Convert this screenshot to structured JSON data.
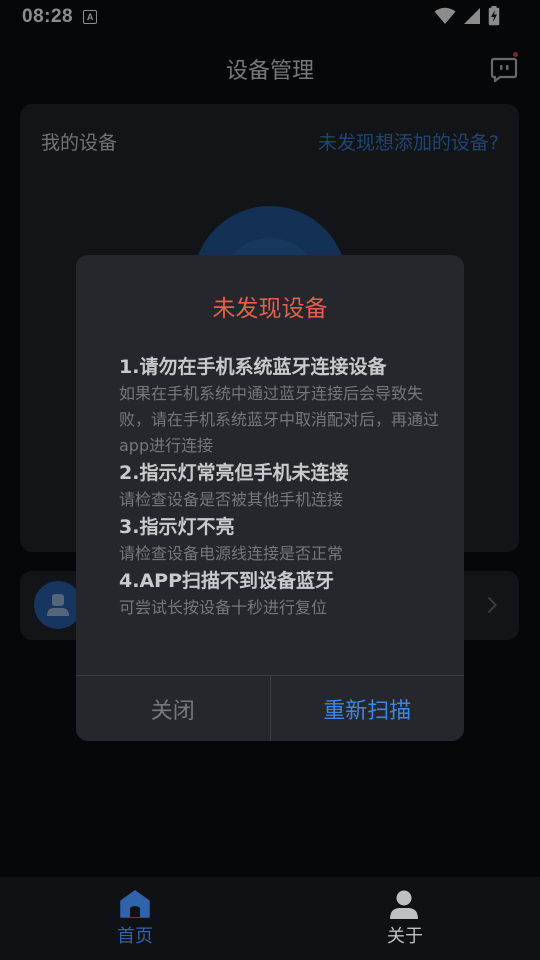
{
  "status_bar": {
    "time": "08:28",
    "notification_badge": "A"
  },
  "header": {
    "title": "设备管理"
  },
  "device_card": {
    "title": "我的设备",
    "link": "未发现想添加的设备?"
  },
  "dialog": {
    "title": "未发现设备",
    "tips": [
      {
        "heading": "1.请勿在手机系统蓝牙连接设备",
        "desc": "如果在手机系统中通过蓝牙连接后会导致失败，请在手机系统蓝牙中取消配对后，再通过app进行连接"
      },
      {
        "heading": "2.指示灯常亮但手机未连接",
        "desc": "请检查设备是否被其他手机连接"
      },
      {
        "heading": "3.指示灯不亮",
        "desc": "请检查设备电源线连接是否正常"
      },
      {
        "heading": "4.APP扫描不到设备蓝牙",
        "desc": "可尝试长按设备十秒进行复位"
      }
    ],
    "close_label": "关闭",
    "rescan_label": "重新扫描"
  },
  "bottom_nav": {
    "items": [
      {
        "label": "首页",
        "icon": "home-icon",
        "active": true
      },
      {
        "label": "关于",
        "icon": "person-icon",
        "active": false
      }
    ]
  },
  "colors": {
    "accent_blue": "#3b86e6",
    "title_red": "#e2604d",
    "background": "#0c0d10",
    "card": "#23252b"
  }
}
